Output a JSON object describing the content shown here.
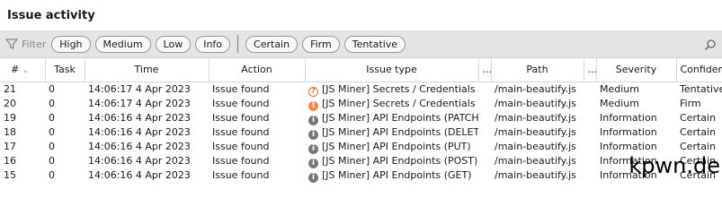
{
  "panel": {
    "title": "Issue activity"
  },
  "filter": {
    "label": "Filter",
    "severity_chips": [
      "High",
      "Medium",
      "Low",
      "Info"
    ],
    "confidence_chips": [
      "Certain",
      "Firm",
      "Tentative"
    ]
  },
  "table": {
    "columns": {
      "num": "#",
      "task": "Task",
      "time": "Time",
      "action": "Action",
      "issue_type": "Issue type",
      "ellipsis1": "...",
      "path": "Path",
      "ellipsis2": "...",
      "severity": "Severity",
      "confidence": "Confidence"
    },
    "rows": [
      {
        "num": "21",
        "task": "0",
        "time": "14:06:17 4 Apr 2023",
        "action": "Issue found",
        "icon": "?",
        "issue_type": "[JS Miner] Secrets / Credentials",
        "path": "/main-beautify.js",
        "severity": "Medium",
        "confidence": "Tentative"
      },
      {
        "num": "20",
        "task": "0",
        "time": "14:06:17 4 Apr 2023",
        "action": "Issue found",
        "icon": "!",
        "issue_type": "[JS Miner] Secrets / Credentials",
        "path": "/main-beautify.js",
        "severity": "Medium",
        "confidence": "Firm"
      },
      {
        "num": "19",
        "task": "0",
        "time": "14:06:16 4 Apr 2023",
        "action": "Issue found",
        "icon": "i",
        "issue_type": "[JS Miner] API Endpoints (PATCH)",
        "path": "/main-beautify.js",
        "severity": "Information",
        "confidence": "Certain"
      },
      {
        "num": "18",
        "task": "0",
        "time": "14:06:16 4 Apr 2023",
        "action": "Issue found",
        "icon": "i",
        "issue_type": "[JS Miner] API Endpoints (DELETE)",
        "path": "/main-beautify.js",
        "severity": "Information",
        "confidence": "Certain"
      },
      {
        "num": "17",
        "task": "0",
        "time": "14:06:16 4 Apr 2023",
        "action": "Issue found",
        "icon": "i",
        "issue_type": "[JS Miner] API Endpoints (PUT)",
        "path": "/main-beautify.js",
        "severity": "Information",
        "confidence": "Certain"
      },
      {
        "num": "16",
        "task": "0",
        "time": "14:06:16 4 Apr 2023",
        "action": "Issue found",
        "icon": "i",
        "issue_type": "[JS Miner] API Endpoints (POST)",
        "path": "/main-beautify.js",
        "severity": "Information",
        "confidence": "Certain"
      },
      {
        "num": "15",
        "task": "0",
        "time": "14:06:16 4 Apr 2023",
        "action": "Issue found",
        "icon": "i",
        "issue_type": "[JS Miner] API Endpoints (GET)",
        "path": "/main-beautify.js",
        "severity": "Information",
        "confidence": "Certain"
      }
    ]
  },
  "watermark": "kpwn.de",
  "colors": {
    "filter_bar_bg": "#e4e4e4",
    "medium_orange": "#f08a4b",
    "info_gray": "#777777"
  }
}
